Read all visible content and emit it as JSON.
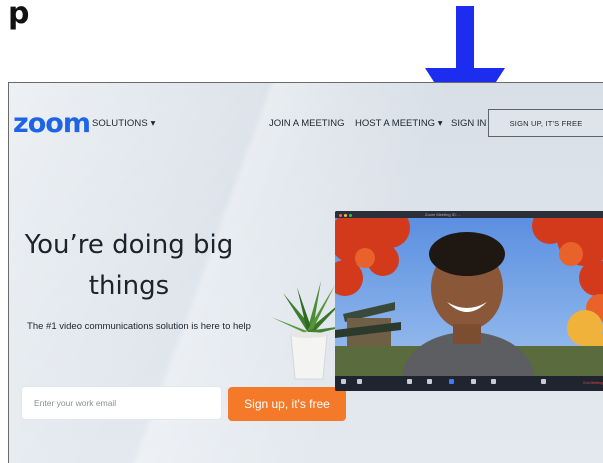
{
  "overlay": {
    "partial_text": "p",
    "arrow_color": "#1c2df0"
  },
  "nav": {
    "logo": "zoom",
    "solutions": "SOLUTIONS",
    "join_meeting": "JOIN A MEETING",
    "host_meeting": "HOST A MEETING",
    "sign_in": "SIGN IN",
    "signup": "SIGN UP, IT'S FREE"
  },
  "hero": {
    "title_line1": "You’re doing big",
    "title_line2": "things",
    "subtitle": "The #1 video communications solution is here to help",
    "email_placeholder": "Enter your work email",
    "cta": "Sign up, it's free"
  },
  "colors": {
    "logo_blue": "#1e64e6",
    "cta_orange": "#f47a2a",
    "arrow_blue": "#1c2df0"
  },
  "video": {
    "window_title": "Zoom Meeting ID: ...",
    "end_label": "End Meeting"
  }
}
